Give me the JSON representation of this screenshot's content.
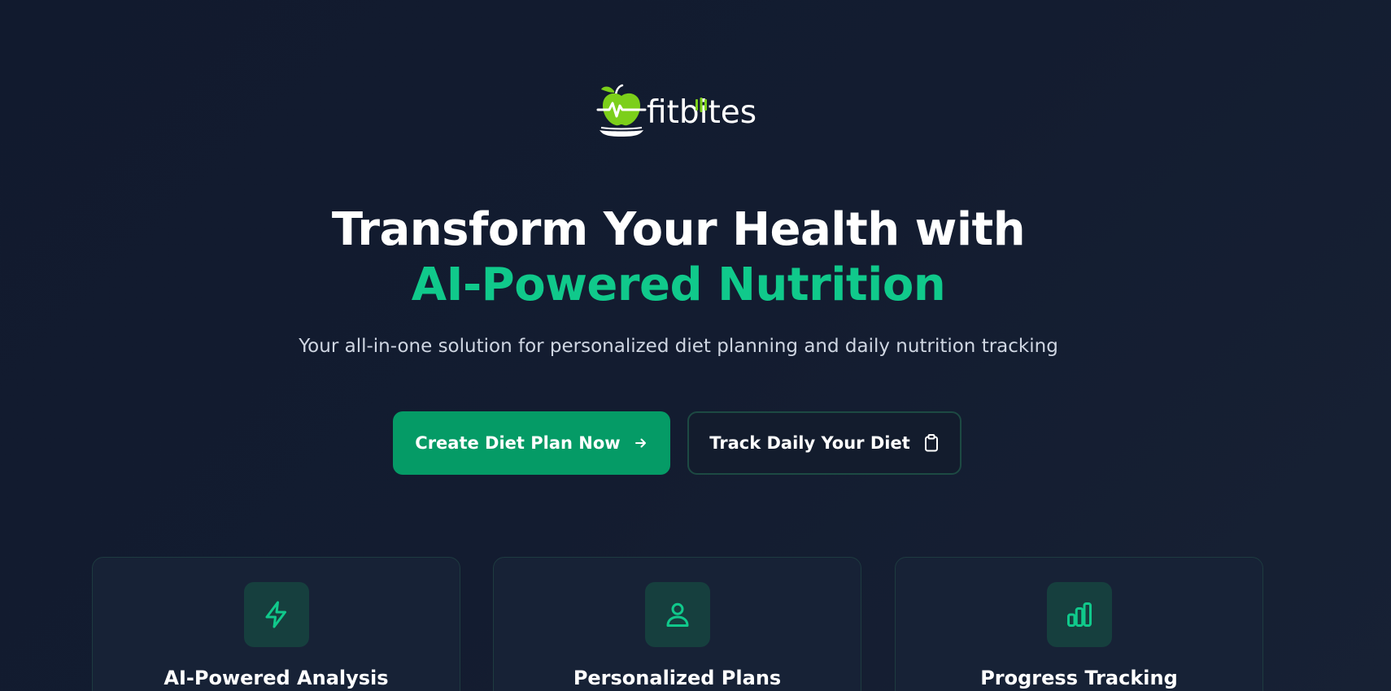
{
  "brand": {
    "name": "fitbites",
    "logo_icon": "apple-heartbeat-icon",
    "colors": {
      "apple_green": "#7ccf1a",
      "accent": "#10c98b"
    }
  },
  "hero": {
    "title_line1": "Transform Your Health with",
    "title_line2": "AI-Powered Nutrition",
    "subtitle": "Your all-in-one solution for personalized diet planning and daily nutrition tracking"
  },
  "actions": {
    "primary_label": "Create Diet Plan Now",
    "primary_icon": "arrow-right-icon",
    "primary_color": "#059b66",
    "secondary_label": "Track Daily Your Diet",
    "secondary_icon": "clipboard-icon"
  },
  "features": [
    {
      "title": "AI-Powered Analysis",
      "icon": "lightning-icon"
    },
    {
      "title": "Personalized Plans",
      "icon": "user-icon"
    },
    {
      "title": "Progress Tracking",
      "icon": "bar-chart-icon"
    }
  ]
}
